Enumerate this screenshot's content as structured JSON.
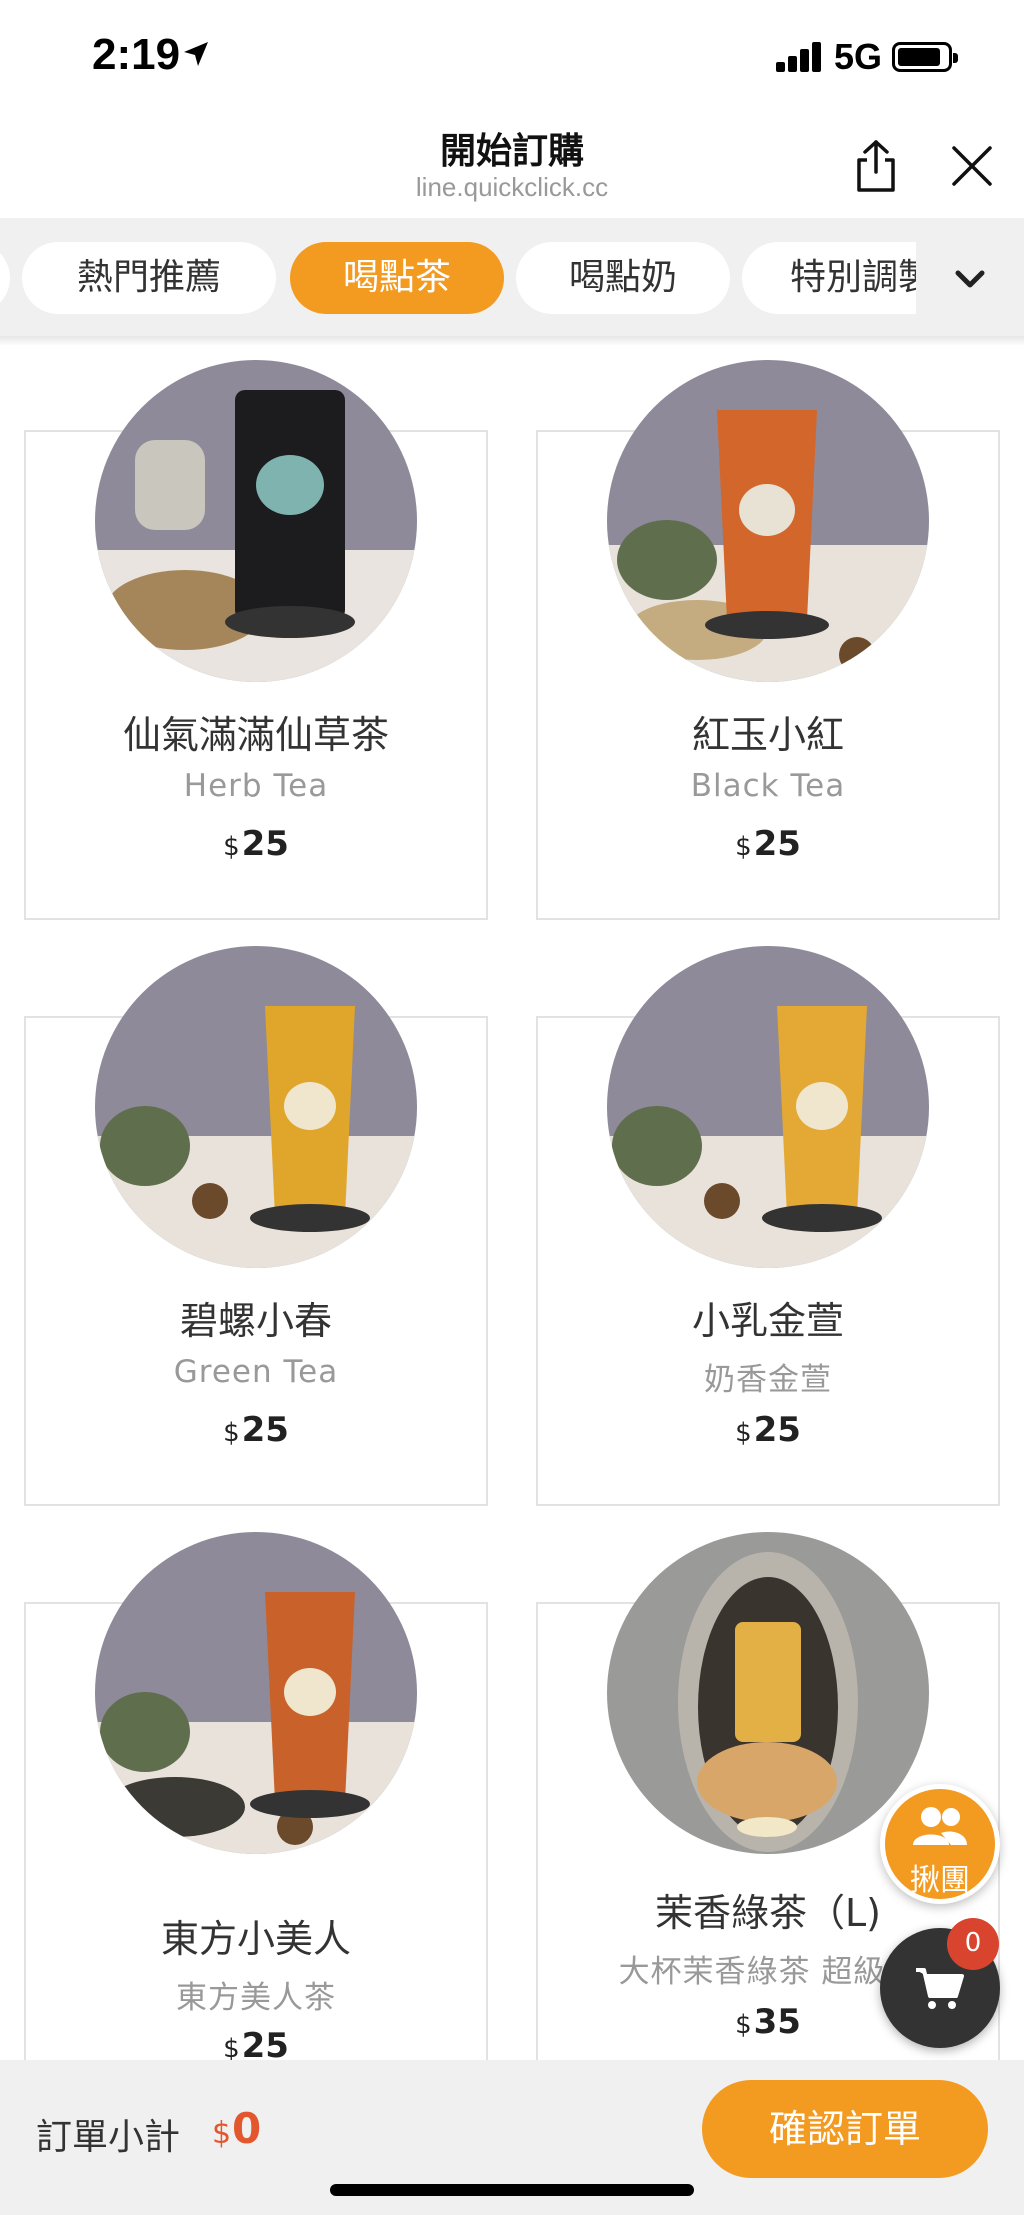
{
  "status_bar": {
    "time": "2:19",
    "network": "5G"
  },
  "header": {
    "title": "開始訂購",
    "url": "line.quickclick.cc"
  },
  "tabs": [
    {
      "label": "熱門推薦",
      "active": false
    },
    {
      "label": "喝點茶",
      "active": true
    },
    {
      "label": "喝點奶",
      "active": false
    },
    {
      "label": "特別調製",
      "active": false
    }
  ],
  "products": [
    {
      "name": "仙氣滿滿仙草茶",
      "subtitle": "Herb Tea",
      "currency": "$",
      "price": "25"
    },
    {
      "name": "紅玉小紅",
      "subtitle": "Black Tea",
      "currency": "$",
      "price": "25"
    },
    {
      "name": "碧螺小春",
      "subtitle": "Green Tea",
      "currency": "$",
      "price": "25"
    },
    {
      "name": "小乳金萱",
      "subtitle": "奶香金萱",
      "currency": "$",
      "price": "25"
    },
    {
      "name": "東方小美人",
      "subtitle": "東方美人茶",
      "currency": "$",
      "price": "25"
    },
    {
      "name": "茉香綠茶（L)",
      "subtitle": "大杯茉香綠茶 超級香",
      "currency": "$",
      "price": "35"
    }
  ],
  "floating": {
    "group_label": "揪團",
    "cart_count": "0"
  },
  "bottom_bar": {
    "subtotal_label": "訂單小計",
    "currency": "$",
    "subtotal": "0",
    "confirm_label": "確認訂單"
  },
  "colors": {
    "accent": "#f39a21",
    "price_red": "#e2572e"
  },
  "icons": [
    "location-arrow-icon",
    "signal-icon",
    "battery-icon",
    "share-icon",
    "close-icon",
    "chevron-down-icon",
    "people-icon",
    "cart-icon"
  ]
}
